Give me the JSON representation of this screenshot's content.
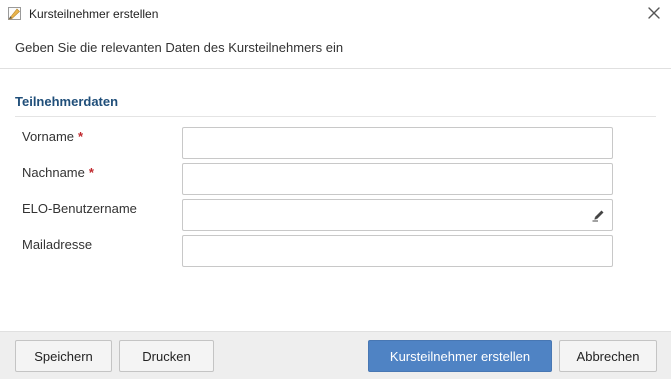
{
  "window": {
    "title": "Kursteilnehmer erstellen"
  },
  "dialog": {
    "subtitle": "Geben Sie die relevanten Daten des Kursteilnehmers ein",
    "section_title": "Teilnehmerdaten"
  },
  "fields": [
    {
      "label": "Vorname",
      "required": "*",
      "value": ""
    },
    {
      "label": "Nachname",
      "required": "*",
      "value": ""
    },
    {
      "label": "ELO-Benutzername",
      "value": "",
      "icon": "pencil-icon"
    },
    {
      "label": "Mailadresse",
      "value": ""
    }
  ],
  "buttons": {
    "save": "Speichern",
    "print": "Drucken",
    "create": "Kursteilnehmer erstellen",
    "cancel": "Abbrechen"
  },
  "colors": {
    "section_title": "#1f4e79",
    "required": "#c0282d",
    "primary_button": "#4f83c4",
    "footer": "#eeeeee"
  }
}
